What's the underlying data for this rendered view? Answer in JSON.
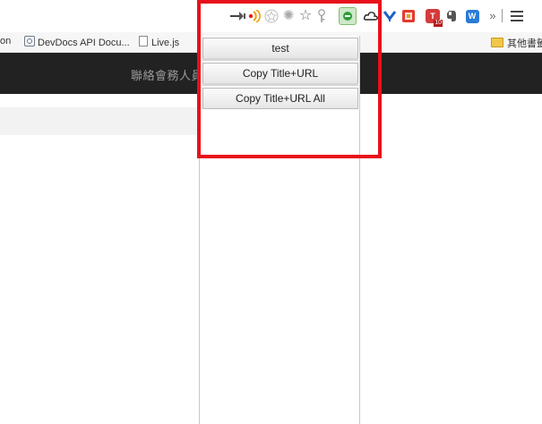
{
  "toolbar": {
    "icons": [
      "pin-icon",
      "rss-icon",
      "star-outline-icon",
      "sun-icon",
      "bookmark-star-icon",
      "key-icon",
      "green-extension-icon",
      "cloud-icon",
      "pocket-icon",
      "red-extension-icon",
      "ttp-extension-icon",
      "evernote-icon",
      "w-extension-icon",
      "overflow-chevron-icon",
      "menu-icon"
    ],
    "overflow_label": "»",
    "ttp_badge": "10",
    "w_label": "W"
  },
  "bookmarks": {
    "items": [
      {
        "label": "on",
        "icon": ""
      },
      {
        "label": "DevDocs API Docu...",
        "icon": "search-icon"
      },
      {
        "label": "Live.js",
        "icon": "page-icon"
      }
    ],
    "other_label": "其他書籤"
  },
  "page": {
    "header_text": "聯絡會務人員"
  },
  "popup": {
    "items": [
      "test",
      "Copy Title+URL",
      "Copy Title+URL All"
    ]
  },
  "colors": {
    "highlight": "#e8101b",
    "darkbar": "#222222",
    "popup_border": "#c8c8c8"
  }
}
